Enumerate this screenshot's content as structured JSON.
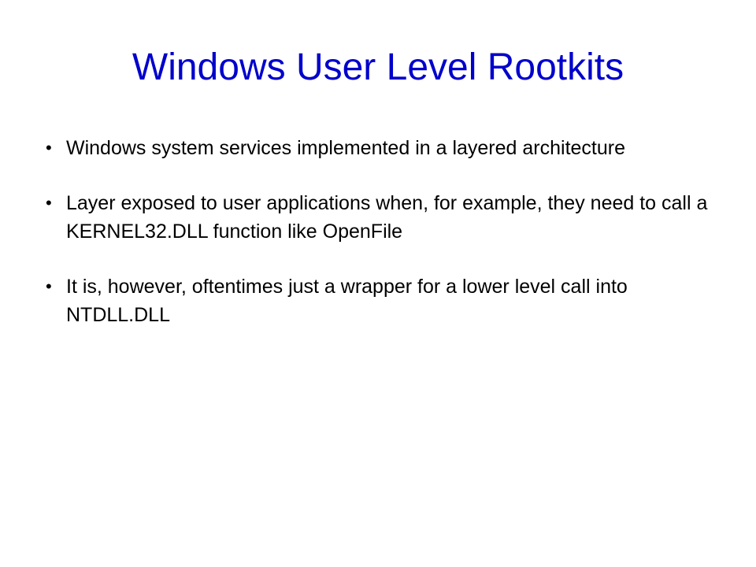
{
  "colors": {
    "background": "#ffffff",
    "title": "#0000cc",
    "body_text": "#000000"
  },
  "slide": {
    "title": "Windows User Level Rootkits",
    "bullet_glyph": "•",
    "bullets": [
      "Windows system services implemented in a layered architecture",
      "Layer exposed to user applications when, for example, they need to call a KERNEL32.DLL function like OpenFile",
      "It is, however, oftentimes just a wrapper for a lower level call into NTDLL.DLL"
    ]
  }
}
